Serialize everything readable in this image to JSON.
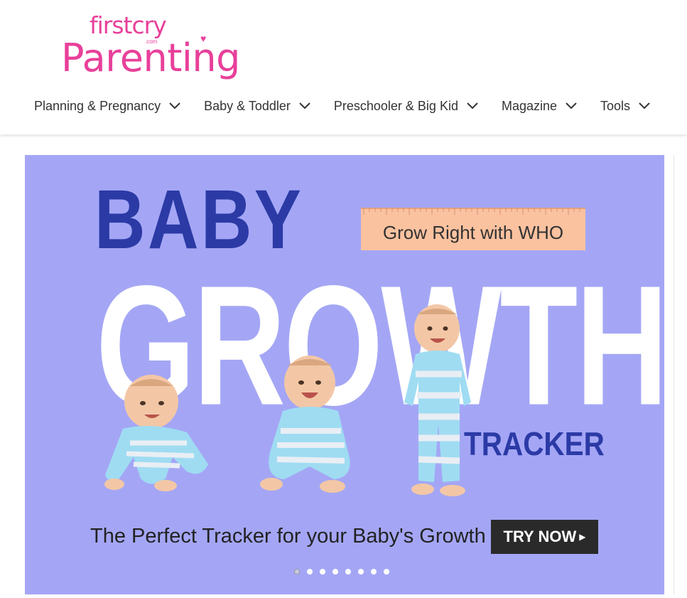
{
  "logo": {
    "brand": "firstcry",
    "brand_suffix": ".com",
    "product": "Parenting"
  },
  "nav": {
    "items": [
      {
        "label": "Planning & Pregnancy"
      },
      {
        "label": "Baby & Toddler"
      },
      {
        "label": "Preschooler & Big Kid"
      },
      {
        "label": "Magazine"
      },
      {
        "label": "Tools"
      }
    ]
  },
  "banner": {
    "title_line1": "BABY",
    "title_line2": "GROWTH",
    "title_line3": "TRACKER",
    "ruler_text": "Grow Right with WHO",
    "tagline": "The Perfect Tracker for your Baby's Growth",
    "cta_label": "TRY NOW",
    "slide_count": 8,
    "active_slide": 1,
    "colors": {
      "background": "#a4a6f5",
      "title_blue": "#2b3aa5",
      "ruler": "#fbc2a0",
      "button": "#2a2a2a",
      "brand_pink": "#e8409a"
    }
  }
}
